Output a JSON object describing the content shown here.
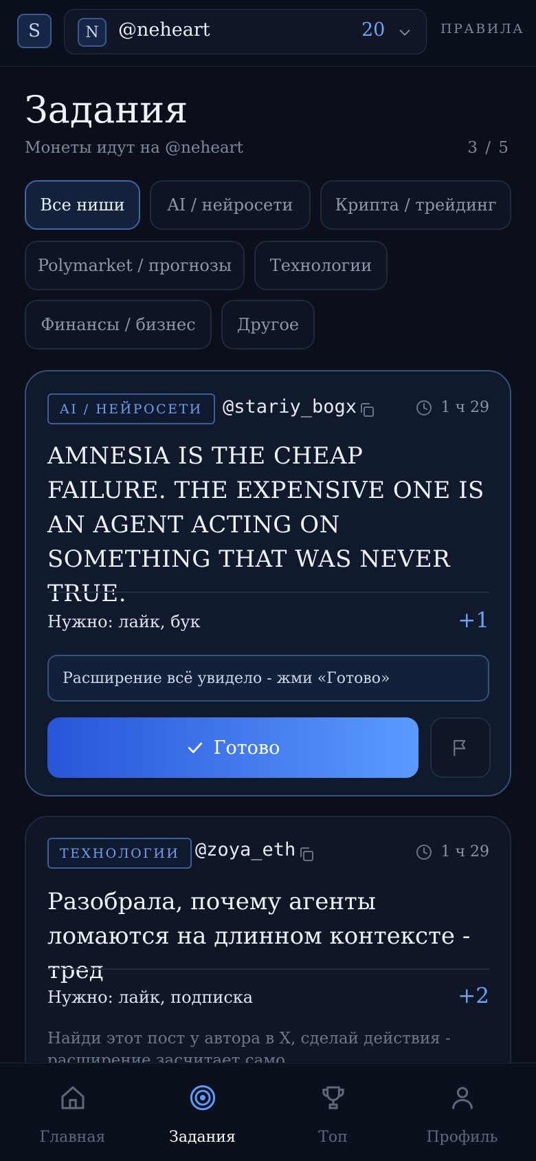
{
  "topbar": {
    "avatar_letter": "S",
    "account": {
      "badge_letter": "N",
      "handle": "@neheart",
      "coins": "20"
    },
    "rules_label": "ПРАВИЛА"
  },
  "header": {
    "title": "Задания",
    "subtitle": "Монеты идут на @neheart",
    "counter": "3 / 5"
  },
  "filters": [
    {
      "label": "Все ниши",
      "active": true
    },
    {
      "label": "AI / нейросети",
      "active": false
    },
    {
      "label": "Крипта / трейдинг",
      "active": false
    },
    {
      "label": "Polymarket / прогнозы",
      "active": false
    },
    {
      "label": "Технологии",
      "active": false
    },
    {
      "label": "Финансы / бизнес",
      "active": false
    },
    {
      "label": "Другое",
      "active": false
    }
  ],
  "tasks": [
    {
      "tag": "AI / НЕЙРОСЕТИ",
      "author": "@stariy_bogx",
      "time": "1 ч 29",
      "text": "AMNESIA IS THE CHEAP FAILURE. THE EXPENSIVE ONE IS AN AGENT ACTING ON SOMETHING THAT WAS NEVER TRUE.",
      "need": "Нужно: лайк, бук",
      "reward": "+1",
      "status_hint": "Расширение всё увидело - жми «Готово»",
      "done_label": "Готово"
    },
    {
      "tag": "ТЕХНОЛОГИИ",
      "author": "@zoya_eth",
      "time": "1 ч 29",
      "text": "Разобрала, почему агенты ломаются на длинном контексте - тред",
      "need": "Нужно: лайк, подписка",
      "reward": "+2",
      "hint": "Найди этот пост у автора в X, сделай действия - расширение засчитает само"
    }
  ],
  "nav": [
    {
      "label": "Главная",
      "icon": "home-icon",
      "active": false
    },
    {
      "label": "Задания",
      "icon": "target-icon",
      "active": true
    },
    {
      "label": "Топ",
      "icon": "trophy-icon",
      "active": false
    },
    {
      "label": "Профиль",
      "icon": "user-icon",
      "active": false
    }
  ],
  "colors": {
    "accent": "#6ea2f5",
    "background": "#0a0f1a",
    "button_start": "#2855d8",
    "button_end": "#5a9bff"
  }
}
